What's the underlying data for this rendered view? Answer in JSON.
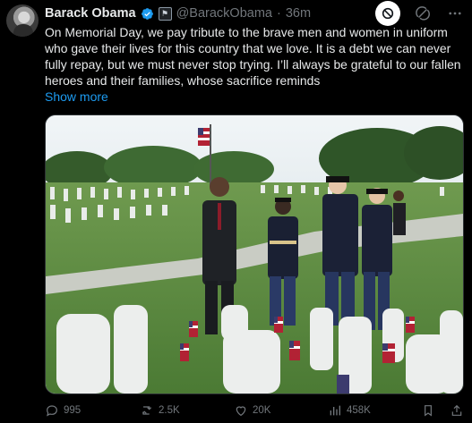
{
  "tweet": {
    "author_name": "Barack Obama",
    "handle": "@BarackObama",
    "separator": "·",
    "time": "36m",
    "text": "On Memorial Day, we pay tribute to the brave men and women in uniform who gave their lives for this country that we love. It is a debt we can never fully repay, but we must never stop trying. I’ll always be grateful to our fallen heroes and their families, whose sacrifice reminds",
    "show_more": "Show more",
    "media_icon": "memorial-day-photo"
  },
  "actions": {
    "replies": "995",
    "reposts": "2.5K",
    "likes": "20K",
    "views": "458K"
  },
  "colors": {
    "background": "#000000",
    "text": "#e7e9ea",
    "muted": "#71767b",
    "link": "#1d9bf0",
    "verified": "#1d9bf0"
  }
}
